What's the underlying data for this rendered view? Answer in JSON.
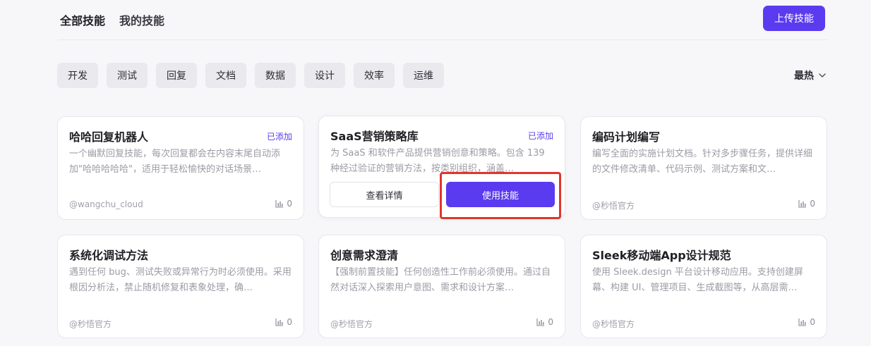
{
  "header": {
    "tabs": [
      {
        "label": "全部技能"
      },
      {
        "label": "我的技能"
      }
    ],
    "upload_label": "上传技能"
  },
  "filters": [
    "开发",
    "测试",
    "回复",
    "文档",
    "数据",
    "设计",
    "效率",
    "运维"
  ],
  "sort": {
    "label": "最热",
    "icon": "chevron-down-icon"
  },
  "cards": [
    {
      "title": "哈哈回复机器人",
      "badge": "已添加",
      "desc": "一个幽默回复技能，每次回复都会在内容末尾自动添加\"哈哈哈哈哈\"，适用于轻松愉快的对话场景…",
      "author": "@wangchu_cloud",
      "count": "0"
    },
    {
      "title": "SaaS营销策略库",
      "badge": "已添加",
      "desc": "为 SaaS 和软件产品提供营销创意和策略。包含 139 种经过验证的营销方法，按类别组织，涵盖…",
      "detail_label": "查看详情",
      "use_label": "使用技能"
    },
    {
      "title": "编码计划编写",
      "desc": "编写全面的实施计划文档。针对多步骤任务，提供详细的文件修改清单、代码示例、测试方案和文…",
      "author": "@秒悟官方",
      "count": "0"
    },
    {
      "title": "系统化调试方法",
      "desc": "遇到任何 bug、测试失败或异常行为时必须使用。采用根因分析法，禁止随机修复和表象处理，确…",
      "author": "@秒悟官方",
      "count": "0"
    },
    {
      "title": "创意需求澄清",
      "desc": "【强制前置技能】任何创造性工作前必须使用。通过自然对话深入探索用户意图、需求和设计方案…",
      "author": "@秒悟官方",
      "count": "0"
    },
    {
      "title": "Sleek移动端App设计规范",
      "desc": "使用 Sleek.design 平台设计移动应用。支持创建屏幕、构建 UI、管理项目、生成截图等，从高层需…",
      "author": "@秒悟官方",
      "count": "0"
    }
  ],
  "colors": {
    "accent": "#5b3bf0",
    "highlight": "#e2352b"
  }
}
